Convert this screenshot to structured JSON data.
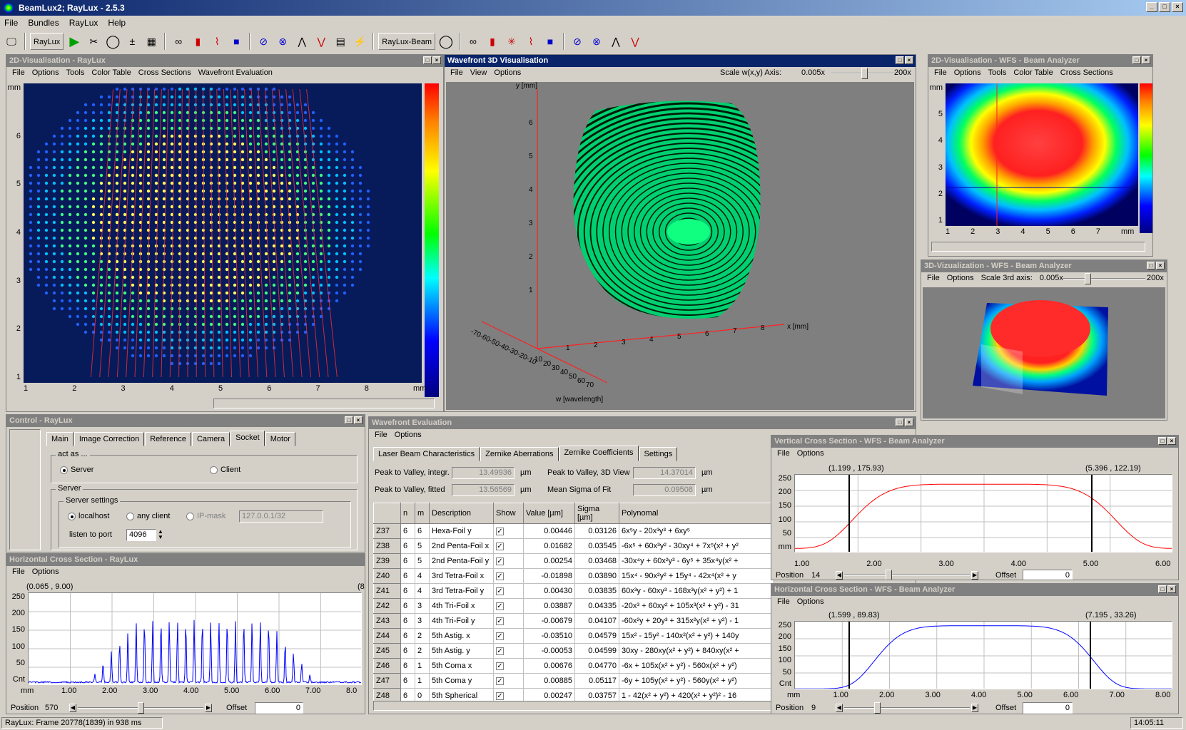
{
  "app": {
    "title": "BeamLux2; RayLux - 2.5.3",
    "menu": [
      "File",
      "Bundles",
      "RayLux",
      "Help"
    ]
  },
  "toolbar": {
    "raylux_label": "RayLux",
    "raylux_beam_label": "RayLux-Beam"
  },
  "vis2d": {
    "title": "2D-Visualisation - RayLux",
    "menu": [
      "File",
      "Options",
      "Tools",
      "Color Table",
      "Cross Sections",
      "Wavefront Evaluation"
    ],
    "xticks": [
      "1",
      "2",
      "3",
      "4",
      "5",
      "6",
      "7",
      "8",
      "mm"
    ],
    "yticks": [
      "mm",
      "6",
      "5",
      "4",
      "3",
      "2",
      "1"
    ]
  },
  "wf3d": {
    "title": "Wavefront 3D Visualisation",
    "menu": [
      "File",
      "View",
      "Options"
    ],
    "scale_label": "Scale w(x,y) Axis:",
    "scale_min": "0.005x",
    "scale_max": "200x",
    "scale_fraction": 0.42,
    "y_axis_label": "y [mm]",
    "x_axis_label": "x [mm]",
    "w_axis_label": "w [wavelength]",
    "yticks": [
      "6",
      "5",
      "4",
      "3",
      "2",
      "1"
    ],
    "xticks": [
      "1",
      "2",
      "3",
      "4",
      "5",
      "6",
      "7",
      "8"
    ],
    "wticks_left": "-70-60-50-40-30-20-10",
    "wticks": [
      "10",
      "20",
      "30",
      "40",
      "50",
      "60",
      "70"
    ]
  },
  "wfs2d": {
    "title": "2D-Visualisation - WFS - Beam Analyzer",
    "menu": [
      "File",
      "Options",
      "Tools",
      "Color Table",
      "Cross Sections"
    ],
    "xticks": [
      "1",
      "2",
      "3",
      "4",
      "5",
      "6",
      "7",
      "mm"
    ],
    "yticks": [
      "mm",
      "5",
      "4",
      "3",
      "2",
      "1"
    ]
  },
  "wfs3d": {
    "title": "3D-Vizualization - WFS - Beam Analyzer",
    "menu": [
      "File",
      "Options"
    ],
    "scale_label": "Scale 3rd axis:",
    "scale_min": "0.005x",
    "scale_max": "200x",
    "scale_fraction": 0.24
  },
  "control": {
    "title": "Control - RayLux",
    "tabs": [
      "Main",
      "Image Correction",
      "Reference",
      "Camera",
      "Socket",
      "Motor"
    ],
    "selected_tab": "Socket",
    "act_as_label": "act as ...",
    "server_label": "Server",
    "client_label": "Client",
    "server_group": "Server",
    "server_settings": "Server settings",
    "localhost": "localhost",
    "any_client": "any client",
    "ip_mask": "IP-mask",
    "ip_value": "127.0.0.1/32",
    "port_label": "listen to port",
    "port_value": "4096"
  },
  "hcross": {
    "title": "Horizontal Cross Section - RayLux",
    "menu": [
      "File",
      "Options"
    ],
    "marker_left": "(0.065 , 9.00)",
    "marker_right": "(8.",
    "yticks": [
      "250",
      "200",
      "150",
      "100",
      "50",
      "Cnt"
    ],
    "xticks": [
      "mm",
      "1.00",
      "2.00",
      "3.00",
      "4.00",
      "5.00",
      "6.00",
      "7.00",
      "8.0"
    ],
    "position_label": "Position",
    "position_value": "570",
    "position_fraction": 0.5,
    "offset_label": "Offset",
    "offset_value": "0"
  },
  "wfeval": {
    "title": "Wavefront Evaluation",
    "menu": [
      "File",
      "Options"
    ],
    "tabs": [
      "Laser Beam Characteristics",
      "Zernike Aberrations",
      "Zernike Coefficients",
      "Settings"
    ],
    "selected_tab": "Zernike Coefficients",
    "pv_integr_label": "Peak to Valley, integr.",
    "pv_integr_value": "13.49936",
    "pv_3d_label": "Peak to Valley, 3D View",
    "pv_3d_value": "14.37014",
    "pv_fitted_label": "Peak to Valley, fitted",
    "pv_fitted_value": "13.56569",
    "sigma_label": "Mean Sigma of Fit",
    "sigma_value": "0.09508",
    "unit": "µm",
    "columns": [
      "",
      "n",
      "m",
      "Description",
      "Show",
      "Value [µm]",
      "Sigma [µm]",
      "Polynomal"
    ],
    "rows": [
      {
        "z": "Z37",
        "n": "6",
        "m": "6",
        "desc": "Hexa-Foil y",
        "value": "0.00446",
        "sigma": "0.03126",
        "poly": "6x⁵y - 20x³y³ + 6xy⁵"
      },
      {
        "z": "Z38",
        "n": "6",
        "m": "5",
        "desc": "2nd Penta-Foil x",
        "value": "0.01682",
        "sigma": "0.03545",
        "poly": "-6x⁵ + 60x³y² - 30xy⁴ + 7x⁵(x² + y²"
      },
      {
        "z": "Z39",
        "n": "6",
        "m": "5",
        "desc": "2nd Penta-Foil y",
        "value": "0.00254",
        "sigma": "0.03468",
        "poly": "-30x⁴y + 60x²y³ - 6y⁵ + 35x⁴y(x² +"
      },
      {
        "z": "Z40",
        "n": "6",
        "m": "4",
        "desc": "3rd Tetra-Foil x",
        "value": "-0.01898",
        "sigma": "0.03890",
        "poly": "15x⁴ - 90x²y² + 15y⁴ - 42x⁴(x² + y"
      },
      {
        "z": "Z41",
        "n": "6",
        "m": "4",
        "desc": "3rd Tetra-Foil y",
        "value": "0.00430",
        "sigma": "0.03835",
        "poly": "60x³y - 60xy³ - 168x³y(x² + y²) + 1"
      },
      {
        "z": "Z42",
        "n": "6",
        "m": "3",
        "desc": "4th Tri-Foil x",
        "value": "0.03887",
        "sigma": "0.04335",
        "poly": "-20x³ + 60xy² + 105x³(x² + y²) - 31"
      },
      {
        "z": "Z43",
        "n": "6",
        "m": "3",
        "desc": "4th Tri-Foil y",
        "value": "-0.00679",
        "sigma": "0.04107",
        "poly": "-60x²y + 20y³ + 315x²y(x² + y²) - 1"
      },
      {
        "z": "Z44",
        "n": "6",
        "m": "2",
        "desc": "5th Astig. x",
        "value": "-0.03510",
        "sigma": "0.04579",
        "poly": "15x² - 15y² - 140x²(x² + y²) + 140y"
      },
      {
        "z": "Z45",
        "n": "6",
        "m": "2",
        "desc": "5th Astig. y",
        "value": "-0.00053",
        "sigma": "0.04599",
        "poly": "30xy - 280xy(x² + y²) + 840xy(x² +"
      },
      {
        "z": "Z46",
        "n": "6",
        "m": "1",
        "desc": "5th Coma x",
        "value": "0.00676",
        "sigma": "0.04770",
        "poly": "-6x + 105x(x² + y²) - 560x(x² + y²)"
      },
      {
        "z": "Z47",
        "n": "6",
        "m": "1",
        "desc": "5th Coma y",
        "value": "0.00885",
        "sigma": "0.05117",
        "poly": "-6y + 105y(x² + y²) - 560y(x² + y²)"
      },
      {
        "z": "Z48",
        "n": "6",
        "m": "0",
        "desc": "5th Spherical",
        "value": "0.00247",
        "sigma": "0.03757",
        "poly": "1 - 42(x² + y²) + 420(x² + y²)² - 16"
      }
    ]
  },
  "vcross": {
    "title": "Vertical Cross Section - WFS - Beam Analyzer",
    "menu": [
      "File",
      "Options"
    ],
    "marker_left": "(1.199 , 175.93)",
    "marker_right": "(5.396 , 122.19)",
    "yticks": [
      "250",
      "200",
      "150",
      "100",
      "50",
      "mm"
    ],
    "xticks": [
      "1.00",
      "2.00",
      "3.00",
      "4.00",
      "5.00",
      "6.00"
    ],
    "position_label": "Position",
    "position_value": "14",
    "position_fraction": 0.35,
    "offset_label": "Offset",
    "offset_value": "0",
    "line_color": "#ff0000"
  },
  "hcross_wfs": {
    "title": "Horizontal Cross Section - WFS - Beam Analyzer",
    "menu": [
      "File",
      "Options"
    ],
    "marker_left": "(1.599 , 89.83)",
    "marker_right": "(7.195 , 33.26)",
    "yticks": [
      "250",
      "200",
      "150",
      "100",
      "50",
      "Cnt"
    ],
    "xticks": [
      "mm",
      "1.00",
      "2.00",
      "3.00",
      "4.00",
      "5.00",
      "6.00",
      "7.00",
      "8.00"
    ],
    "position_label": "Position",
    "position_value": "9",
    "position_fraction": 0.25,
    "offset_label": "Offset",
    "offset_value": "0",
    "line_color": "#0000ff"
  },
  "status": {
    "frame": "RayLux: Frame 20778(1839) in 938 ms",
    "time": "14:05:11"
  }
}
